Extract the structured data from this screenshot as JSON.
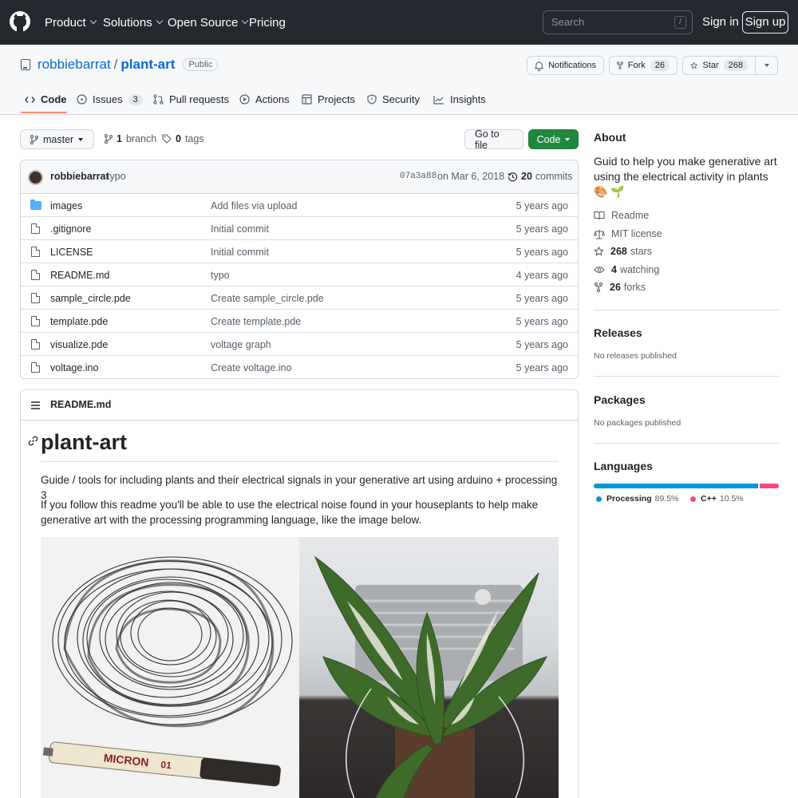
{
  "colors": {
    "header_bg": "#24292f",
    "link": "#0969da",
    "green_button": "#1f883d",
    "folder": "#54aeff",
    "tab_underline": "#fd8c73",
    "processing": "#0096d8",
    "cpp": "#f34b7d"
  },
  "header": {
    "nav": [
      "Product",
      "Solutions",
      "Open Source",
      "Pricing"
    ],
    "search_placeholder": "Search",
    "search_shortcut": "/",
    "signin": "Sign in",
    "signup": "Sign up"
  },
  "repo": {
    "owner": "robbiebarrat",
    "separator": "/",
    "name": "plant-art",
    "visibility": "Public",
    "notifications": "Notifications",
    "fork_label": "Fork",
    "fork_count": "26",
    "star_label": "Star",
    "star_count": "268"
  },
  "tabs": [
    {
      "label": "Code",
      "icon": "code-icon"
    },
    {
      "label": "Issues",
      "count": "3",
      "icon": "issue-icon"
    },
    {
      "label": "Pull requests",
      "icon": "pull-request-icon"
    },
    {
      "label": "Actions",
      "icon": "play-icon"
    },
    {
      "label": "Projects",
      "icon": "table-icon"
    },
    {
      "label": "Security",
      "icon": "shield-icon"
    },
    {
      "label": "Insights",
      "icon": "graph-icon"
    }
  ],
  "toolbar": {
    "branch": "master",
    "branches_count": "1",
    "branches_label": "branch",
    "tags_count": "0",
    "tags_label": "tags",
    "go_to_file": "Go to file",
    "code": "Code"
  },
  "commit": {
    "author": "robbiebarrat",
    "message": "typo",
    "hash": "07a3a88",
    "date": "on Mar 6, 2018",
    "count": "20",
    "count_label": "commits"
  },
  "files": [
    {
      "name": "images",
      "type": "dir",
      "message": "Add files via upload",
      "age": "5 years ago"
    },
    {
      "name": ".gitignore",
      "type": "file",
      "message": "Initial commit",
      "age": "5 years ago"
    },
    {
      "name": "LICENSE",
      "type": "file",
      "message": "Initial commit",
      "age": "5 years ago"
    },
    {
      "name": "README.md",
      "type": "file",
      "message": "typo",
      "age": "4 years ago"
    },
    {
      "name": "sample_circle.pde",
      "type": "file",
      "message": "Create sample_circle.pde",
      "age": "5 years ago"
    },
    {
      "name": "template.pde",
      "type": "file",
      "message": "Create template.pde",
      "age": "5 years ago"
    },
    {
      "name": "visualize.pde",
      "type": "file",
      "message": "voltage graph",
      "age": "5 years ago"
    },
    {
      "name": "voltage.ino",
      "type": "file",
      "message": "Create voltage.ino",
      "age": "5 years ago"
    }
  ],
  "readme": {
    "filename": "README.md",
    "heading": "plant-art",
    "para1": "Guide / tools for including plants and their electrical signals in your generative art using arduino + processing 3",
    "para2": "If you follow this readme you'll be able to use the electrical noise found in your houseplants to help make generative art with the processing programming language, like the image below.",
    "pen_brand": "MICRON",
    "pen_size": "01"
  },
  "about": {
    "title": "About",
    "description": "Guid to help you make generative art using the electrical activity in plants 🎨 🌱",
    "readme": "Readme",
    "license": "MIT license",
    "stars_count": "268",
    "stars_label": "stars",
    "watching_count": "4",
    "watching_label": "watching",
    "forks_count": "26",
    "forks_label": "forks"
  },
  "releases": {
    "title": "Releases",
    "empty": "No releases published"
  },
  "packages": {
    "title": "Packages",
    "empty": "No packages published"
  },
  "languages": {
    "title": "Languages",
    "items": [
      {
        "name": "Processing",
        "percent": "89.5%",
        "value": 89.5
      },
      {
        "name": "C++",
        "percent": "10.5%",
        "value": 10.5
      }
    ]
  }
}
